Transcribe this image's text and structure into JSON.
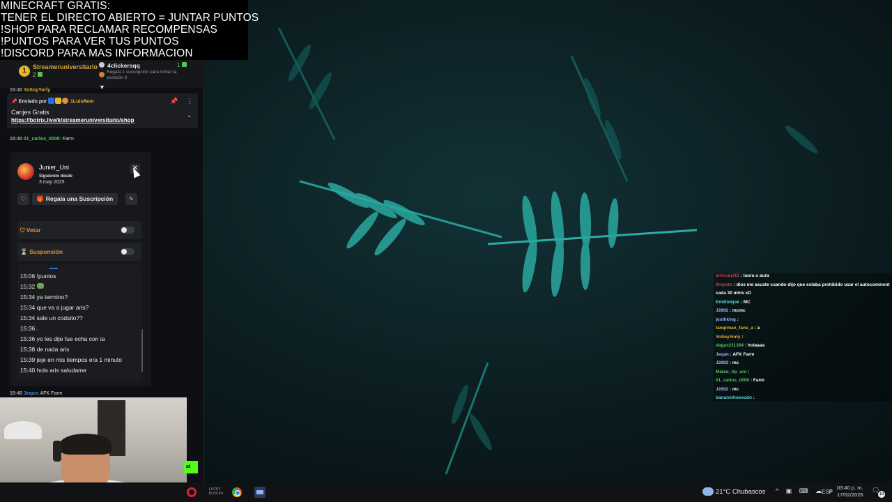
{
  "overlay_lines": [
    "MINECRAFT GRATIS:",
    "TENER EL DIRECTO ABIERTO = JUNTAR PUNTOS",
    "!SHOP PARA RECLAMAR RECOMPENSAS",
    "!PUNTOS PARA VER TUS PUNTOS",
    "!DISCORD PARA MAS INFORMACION"
  ],
  "leaderboard": {
    "first_rank": "1",
    "first_name": "Streameruniversitario",
    "first_points": "2",
    "second_name": "4clickersqq",
    "second_points": "1",
    "sub_text": "Regala 1 suscripción para tomar la posición 3"
  },
  "pinned": {
    "sent_by_label": "Enviado por",
    "sender": "1LuisRem",
    "title": "Canjes Gratis",
    "link": "https://botrix.live/k/streameruniversitario/shop"
  },
  "chat_lines": [
    {
      "time": "15:40",
      "user": "01_carlos_0000",
      "user_color": "#59c659",
      "text": "Farm"
    },
    {
      "time": "15:40",
      "user": "Jeqan",
      "user_color": "#3a8ee0",
      "text": "AFK Farm"
    }
  ],
  "user_card": {
    "username": "Junier_Uni",
    "following_label": "Siguiendo desde",
    "following_date": "3 may 2025",
    "gift_label": "Regala una Suscripción",
    "ban_label": "Vetar",
    "timeout_label": "Suspensión",
    "history": [
      "15:06 !puntos",
      "15:32",
      "15:34 ya termino?",
      "15:34 que va a jugar aris?",
      "15:34 sale un codsito??",
      "15:36 .",
      "15:36 yo les dije fue echa con ia",
      "15:38 de nada aris",
      "15:39 jeje en mis tiempos era 1 minuto",
      "15:40 hola aris saludame"
    ]
  },
  "chat_button": "at",
  "overlay_chat": [
    {
      "user": "artocalyi15",
      "color": "#d04040",
      "text": "laura o aura"
    },
    {
      "user": "Itrayoto",
      "color": "#d04040",
      "text": "dios me asuste cuando dijo que estaba prohibido usar el autocomment"
    },
    {
      "user": "",
      "color": "#ffffff",
      "text": "cada 30 mins xD"
    },
    {
      "user": "Emilliokjsk",
      "color": "#5fd6d6",
      "text": "MC"
    },
    {
      "user": "J2892",
      "color": "#9fb4ff",
      "text": "mcmc"
    },
    {
      "user": "justhking",
      "color": "#9fb4ff",
      "text": ""
    },
    {
      "user": "tanqrman_fans_a",
      "color": "#e3b72c",
      "text": "a"
    },
    {
      "user": "YoSoyYorly",
      "color": "#e3b72c",
      "text": ""
    },
    {
      "user": "dagas211304",
      "color": "#59c659",
      "text": "holaaaa"
    },
    {
      "user": "Jeqan",
      "color": "#9fb4ff",
      "text": "AFK Farm"
    },
    {
      "user": "J2892",
      "color": "#9fb4ff",
      "text": "mc"
    },
    {
      "user": "Mateo_rip_uni",
      "color": "#59c659",
      "text": ""
    },
    {
      "user": "01_carlos_0000",
      "color": "#59c659",
      "text": "Farm"
    },
    {
      "user": "J2892",
      "color": "#9fb4ff",
      "text": "mc"
    },
    {
      "user": "bananinhuesudo",
      "color": "#5fd6d6",
      "text": ""
    }
  ],
  "taskbar": {
    "weather": "21°C  Chubascos",
    "language": "ESP",
    "time": "03:40 p. m.",
    "date": "17/02/2026",
    "notifications": "19",
    "lucky_label": "LUCKY BLOCKS"
  }
}
